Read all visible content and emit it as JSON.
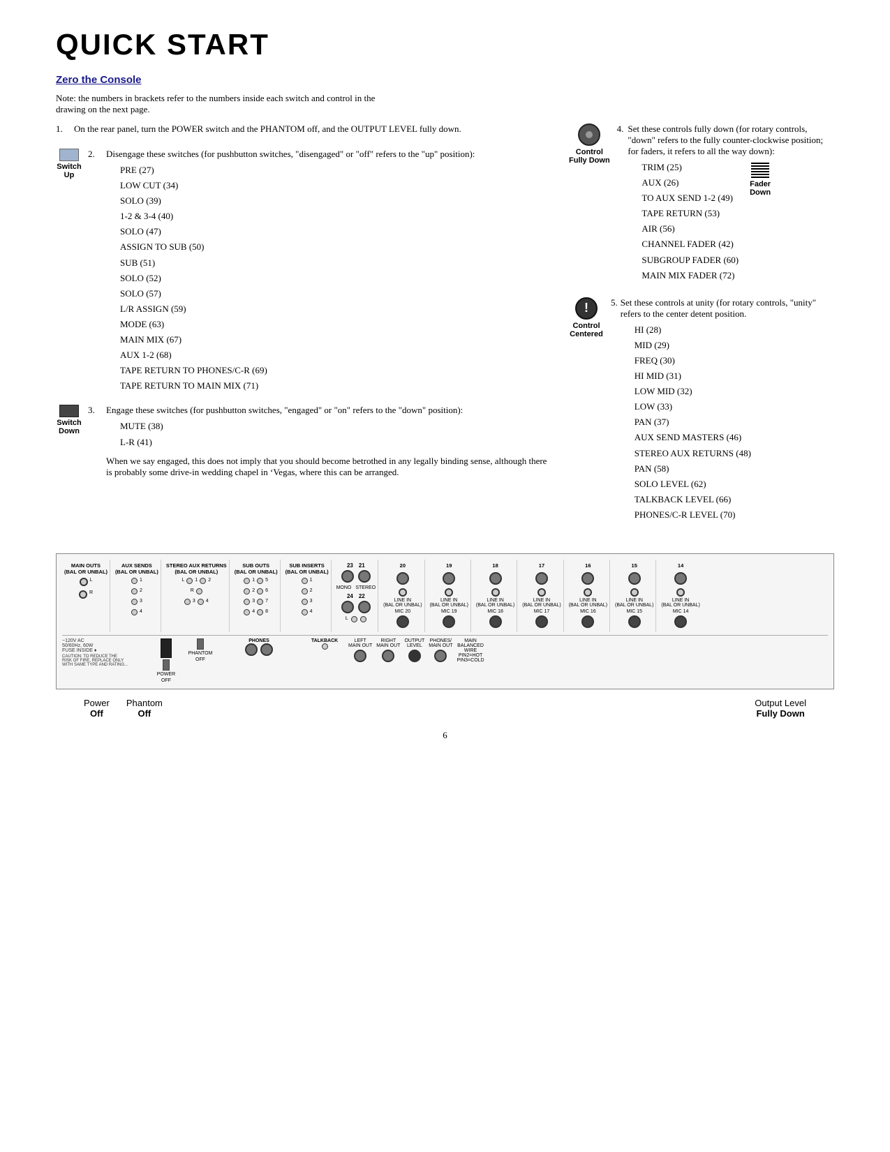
{
  "page": {
    "title": "Quick Start",
    "section_title": "Zero the Console",
    "note": "Note: the numbers in brackets refer to the numbers inside each switch and control in the drawing on the next page.",
    "page_number": "6"
  },
  "steps": {
    "step1": {
      "num": "1.",
      "text": "On the rear panel, turn the POWER switch and the PHANTOM off, and the OUTPUT LEVEL fully down."
    },
    "step2": {
      "num": "2.",
      "icon_label_top": "Switch",
      "icon_label_bottom": "Up",
      "intro": "Disengage these switches (for pushbutton switches, \"disengaged\" or \"off\" refers to the \"up\" position):",
      "items": [
        "PRE (27)",
        "LOW CUT (34)",
        "SOLO (39)",
        "1-2 & 3-4 (40)",
        "SOLO (47)",
        "ASSIGN TO SUB (50)",
        "SUB (51)",
        "SOLO (52)",
        "SOLO (57)",
        "L/R ASSIGN (59)",
        "MODE (63)",
        "MAIN MIX (67)",
        "AUX 1-2 (68)",
        "TAPE RETURN TO PHONES/C-R (69)",
        "TAPE RETURN TO MAIN MIX (71)"
      ]
    },
    "step3": {
      "num": "3.",
      "icon_label_top": "Switch",
      "icon_label_bottom": "Down",
      "intro": "Engage these switches (for pushbutton switches, \"engaged\" or \"on\" refers to the \"down\" position):",
      "items": [
        "MUTE (38)",
        "L-R (41)"
      ],
      "extra_text": "When we say engaged, this does not imply that you should become betrothed in any legally binding sense, although there is probably some drive-in wedding chapel in ‘Vegas, where this can be arranged."
    },
    "step4": {
      "num": "4.",
      "icon_label_top": "Control",
      "icon_label_bottom": "Fully Down",
      "intro": "Set these controls fully down (for rotary controls, \"down\" refers to the fully counter-clockwise position; for faders, it refers to all the way down):",
      "items": [
        "TRIM (25)",
        "AUX (26)",
        "TO AUX SEND 1-2 (49)",
        "TAPE RETURN (53)",
        "AIR (56)",
        "CHANNEL FADER (42)",
        "SUBGROUP FADER (60)",
        "MAIN MIX FADER (72)"
      ],
      "fader_label_top": "Fader",
      "fader_label_bottom": "Down"
    },
    "step5": {
      "num": "5.",
      "icon_label_top": "Control",
      "icon_label_bottom": "Centered",
      "intro": "Set these controls at unity (for rotary controls, \"unity\" refers to the center detent position.",
      "items": [
        "HI (28)",
        "MID (29)",
        "FREQ (30)",
        "HI MID (31)",
        "LOW MID (32)",
        "LOW (33)",
        "PAN (37)",
        "AUX SEND MASTERS (46)",
        "STEREO AUX RETURNS (48)",
        "PAN (58)",
        "SOLO LEVEL (62)",
        "TALKBACK LEVEL (66)",
        "PHONES/C-R LEVEL (70)"
      ]
    }
  },
  "bottom_labels": {
    "power_label": "Power",
    "power_value": "Off",
    "phantom_label": "Phantom",
    "phantom_value": "Off",
    "output_label": "Output Level",
    "output_value": "Fully Down"
  }
}
